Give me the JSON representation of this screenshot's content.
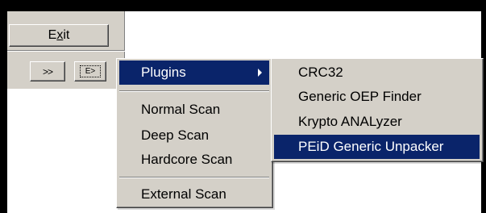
{
  "toolbar": {
    "exit_label": "Exit",
    "exit_accel": "x",
    "fast_forward_label": ">>",
    "scan_icon_label": "E>"
  },
  "main_menu": {
    "items": [
      {
        "label": "Plugins",
        "highlighted": true,
        "has_submenu": true
      },
      {
        "label": "Normal Scan"
      },
      {
        "label": "Deep Scan"
      },
      {
        "label": "Hardcore Scan"
      },
      {
        "label": "External Scan"
      }
    ]
  },
  "plugins_submenu": {
    "items": [
      {
        "label": "CRC32"
      },
      {
        "label": "Generic OEP Finder"
      },
      {
        "label": "Krypto ANALyzer"
      },
      {
        "label": "PEiD Generic Unpacker",
        "highlighted": true
      }
    ]
  },
  "colors": {
    "face": "#d4d0c8",
    "highlight": "#0a246a",
    "highlight_text": "#ffffff",
    "frame": "#000000"
  },
  "icons": {
    "submenu_arrow": "chevron-right-icon",
    "scan_button": "scan-icon"
  }
}
